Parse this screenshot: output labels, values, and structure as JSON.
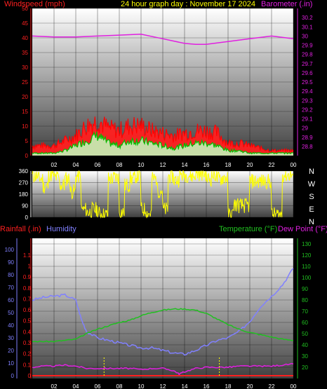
{
  "header": {
    "windspeed_label": "Windspeed (mph)",
    "title": "24 hour graph day : November 17 2024",
    "barometer_label": "Barometer (.in)"
  },
  "colors": {
    "windspeed": "#ff2020",
    "gust": "#ff0000",
    "avg": "#00c000",
    "barometer": "#e020e0",
    "direction": "#ffff00",
    "humidity": "#8080ff",
    "temperature": "#20c020",
    "dewpoint": "#e020e0",
    "rainfall": "#ff2020",
    "title": "#ffff00",
    "lowspeed": "#c0ffc0"
  },
  "chart_data": [
    {
      "type": "line",
      "x_ticks": [
        "02",
        "04",
        "06",
        "08",
        "10",
        "12",
        "14",
        "16",
        "18",
        "20",
        "22",
        "00"
      ],
      "y_left_label": "Windspeed (mph)",
      "y_left_ticks": [
        0,
        5,
        10,
        15,
        20,
        25,
        30,
        35,
        40,
        45,
        50
      ],
      "ylim_left": [
        0,
        50
      ],
      "y_right_label": "Barometer (.in)",
      "y_right_ticks": [
        "28.8",
        "28.9",
        "29",
        "29.1",
        "29.2",
        "29.3",
        "29.4",
        "29.5",
        "29.6",
        "29.7",
        "29.8",
        "29.9",
        "30",
        "30.1",
        "30.2"
      ],
      "ylim_right": [
        28.7,
        30.3
      ],
      "series": [
        {
          "name": "Windspeed (mph)",
          "axis": "left",
          "x": [
            0,
            1,
            2,
            3,
            4,
            5,
            6,
            7,
            8,
            9,
            10,
            11,
            12,
            13,
            14,
            15,
            16,
            17,
            18,
            19,
            20,
            21,
            22,
            23,
            24
          ],
          "values": [
            4,
            4,
            4,
            6,
            8,
            12,
            14,
            11,
            10,
            12,
            12,
            10,
            9,
            8,
            9,
            10,
            10,
            9,
            5,
            5,
            4,
            3,
            2,
            2,
            2
          ]
        },
        {
          "name": "Average",
          "axis": "left",
          "x": [
            0,
            1,
            2,
            3,
            4,
            5,
            6,
            7,
            8,
            9,
            10,
            11,
            12,
            13,
            14,
            15,
            16,
            17,
            18,
            19,
            20,
            21,
            22,
            23,
            24
          ],
          "values": [
            1,
            1,
            1,
            2,
            4,
            6,
            8,
            5,
            4,
            6,
            6,
            5,
            4,
            3,
            4,
            5,
            5,
            4,
            2,
            2,
            1,
            1,
            1,
            1,
            1
          ]
        },
        {
          "name": "Barometer (.in)",
          "axis": "right",
          "x": [
            0,
            2,
            4,
            6,
            8,
            10,
            12,
            14,
            15,
            16,
            18,
            20,
            22,
            24
          ],
          "values": [
            30.0,
            29.99,
            29.99,
            30.0,
            30.01,
            30.02,
            29.97,
            29.92,
            29.91,
            29.91,
            29.94,
            29.97,
            30.0,
            29.97
          ]
        }
      ]
    },
    {
      "type": "line",
      "y_ticks": [
        0,
        90,
        180,
        270,
        360
      ],
      "ylim": [
        0,
        360
      ],
      "compass_labels": [
        "N",
        "W",
        "S",
        "E",
        "N"
      ],
      "series": [
        {
          "name": "Wind direction",
          "x": [
            0,
            0.5,
            1,
            1.5,
            2,
            2.5,
            3,
            3.5,
            4,
            4.5,
            5,
            5.5,
            6,
            6.5,
            7,
            7.5,
            8,
            8.5,
            9,
            9.5,
            10,
            10.5,
            11,
            11.5,
            12,
            12.5,
            13,
            13.5,
            14,
            14.5,
            15,
            15.5,
            16,
            16.5,
            17,
            17.5,
            18,
            18.5,
            19,
            19.5,
            20,
            20.5,
            21,
            21.5,
            22,
            22.5,
            23,
            23.5,
            24
          ],
          "values": [
            320,
            300,
            240,
            330,
            310,
            250,
            300,
            200,
            320,
            60,
            40,
            60,
            30,
            20,
            300,
            310,
            40,
            250,
            300,
            320,
            60,
            30,
            300,
            210,
            60,
            320,
            290,
            330,
            330,
            320,
            340,
            340,
            300,
            330,
            300,
            310,
            20,
            100,
            90,
            90,
            280,
            280,
            280,
            280,
            20,
            20,
            330,
            330,
            330
          ]
        }
      ]
    },
    {
      "type": "line",
      "x_ticks": [
        "02",
        "04",
        "06",
        "08",
        "10",
        "12",
        "14",
        "16",
        "18",
        "20",
        "22",
        "00"
      ],
      "legend": [
        "Rainfall (.in)",
        "Humidity",
        "Temperature (°F)",
        "Dew Point (°F)"
      ],
      "y_left_humidity_ticks": [
        0,
        10,
        20,
        30,
        40,
        50,
        60,
        70,
        80,
        90,
        100
      ],
      "y_left_rain_ticks": [
        "0",
        "0.1",
        "0.2",
        "0.3",
        "0.4",
        "0.5",
        "0.6",
        "0.7",
        "0.8",
        "0.9",
        "1",
        "1.1"
      ],
      "y_right_ticks": [
        20,
        30,
        40,
        50,
        60,
        70,
        80,
        90,
        100,
        110,
        120,
        130
      ],
      "ylim_right": [
        10,
        135
      ],
      "series": [
        {
          "name": "Humidity",
          "axis": "left",
          "x": [
            0,
            1,
            2,
            3,
            4,
            4.5,
            5,
            6,
            7,
            8,
            9,
            10,
            11,
            12,
            13,
            14,
            15,
            16,
            17,
            18,
            19,
            20,
            21,
            22,
            23,
            24
          ],
          "values": [
            60,
            62,
            63,
            64,
            60,
            45,
            35,
            30,
            28,
            26,
            24,
            22,
            22,
            20,
            18,
            17,
            20,
            24,
            28,
            30,
            35,
            43,
            55,
            63,
            72,
            85
          ]
        },
        {
          "name": "Temperature (°F)",
          "axis": "right",
          "x": [
            0,
            1,
            2,
            3,
            4,
            5,
            6,
            7,
            8,
            9,
            10,
            11,
            12,
            13,
            14,
            15,
            16,
            17,
            18,
            19,
            20,
            21,
            22,
            23,
            24
          ],
          "values": [
            43,
            43,
            43,
            44,
            45,
            50,
            54,
            57,
            60,
            62,
            66,
            69,
            71,
            72,
            72,
            71,
            68,
            63,
            58,
            54,
            51,
            49,
            47,
            45,
            44
          ]
        },
        {
          "name": "Dew Point (°F)",
          "axis": "right",
          "x": [
            0,
            1,
            2,
            3,
            4,
            5,
            6,
            7,
            8,
            9,
            10,
            11,
            12,
            13,
            13.5,
            14,
            15,
            16,
            17,
            18,
            19,
            20,
            21,
            22,
            23,
            24
          ],
          "values": [
            20,
            21,
            21,
            22,
            21,
            19,
            19,
            19,
            19,
            19,
            18,
            19,
            19,
            17,
            14,
            16,
            19,
            20,
            20,
            20,
            21,
            21,
            21,
            21,
            22,
            23
          ]
        },
        {
          "name": "Rainfall (.in)",
          "axis": "left",
          "x": [
            0,
            24
          ],
          "values": [
            0,
            0
          ]
        }
      ]
    }
  ]
}
